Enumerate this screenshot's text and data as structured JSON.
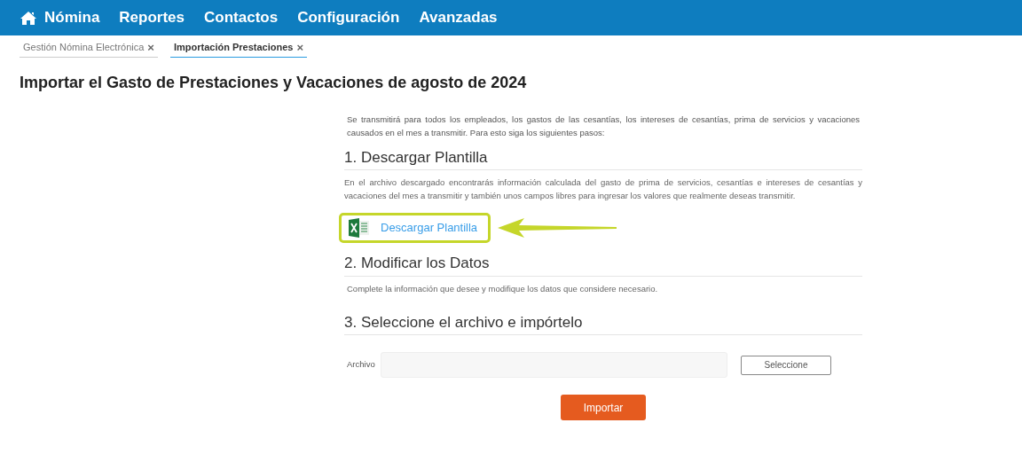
{
  "nav": {
    "items": [
      {
        "label": "Nómina",
        "kind": "home"
      },
      {
        "label": "Reportes",
        "kind": "plain"
      },
      {
        "label": "Contactos",
        "kind": "plain"
      },
      {
        "label": "Configuración",
        "kind": "plain"
      },
      {
        "label": "Avanzadas",
        "kind": "plain"
      }
    ]
  },
  "tabs": [
    {
      "label": "Gestión Nómina Electrónica",
      "close": "×",
      "selected": false
    },
    {
      "label": "Importación Prestaciones",
      "close": "×",
      "selected": true
    }
  ],
  "title": "Importar el Gasto de Prestaciones y Vacaciones de agosto de 2024",
  "intro": "Se transmitirá para todos los empleados, los gastos de las cesantías, los intereses de cesantías, prima de servicios y vacaciones causados en el mes a transmitir. Para esto siga los siguientes pasos:",
  "steps": [
    {
      "heading": "1. Descargar Plantilla",
      "text": "En el archivo descargado encontrarás información calculada del gasto de prima de servicios, cesantías e intereses de cesantías y vacaciones del mes a transmitir y también unos campos libres para ingresar los valores que realmente deseas transmitir.",
      "kind": "download",
      "link": "Descargar Plantilla"
    },
    {
      "heading": "2. Modificar los Datos",
      "text": "Complete la información que desee y modifique los datos que considere necesario.",
      "kind": "text"
    },
    {
      "heading": "3. Seleccione el archivo e impórtelo",
      "kind": "upload",
      "field_label": "Archivo",
      "select_button": "Seleccione",
      "import_button": "Importar"
    }
  ]
}
